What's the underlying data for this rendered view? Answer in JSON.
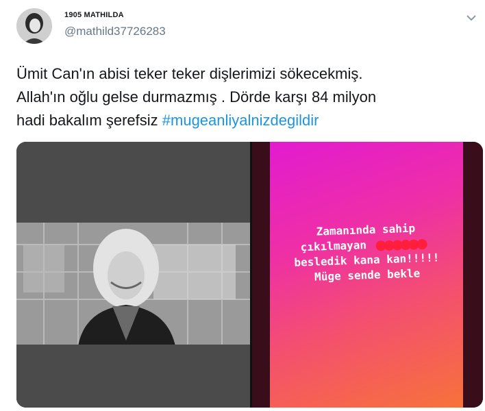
{
  "user": {
    "display_name": "1905 MATHILDA",
    "handle": "@mathild37726283"
  },
  "tweet": {
    "line1": "Ümit Can'ın abisi teker teker dişlerimizi sökecekmiş.",
    "line2": "Allah'ın oğlu gelse durmazmış . Dörde  karşı 84 milyon",
    "line3_text": "hadi bakalım şerefsiz ",
    "hashtag": "#mugeanliyalnizdegildir"
  },
  "story": {
    "line1": "Zamanında sahip",
    "line2_prefix": "çıkılmayan",
    "line3": "besledik kana kan!!!!!",
    "line4": "Müge sende bekle"
  },
  "icons": {
    "caret": "chevron-down-icon"
  },
  "colors": {
    "hashtag": "#1b95e0",
    "handle": "#657786",
    "censor_dots": "#ff1f3d"
  }
}
